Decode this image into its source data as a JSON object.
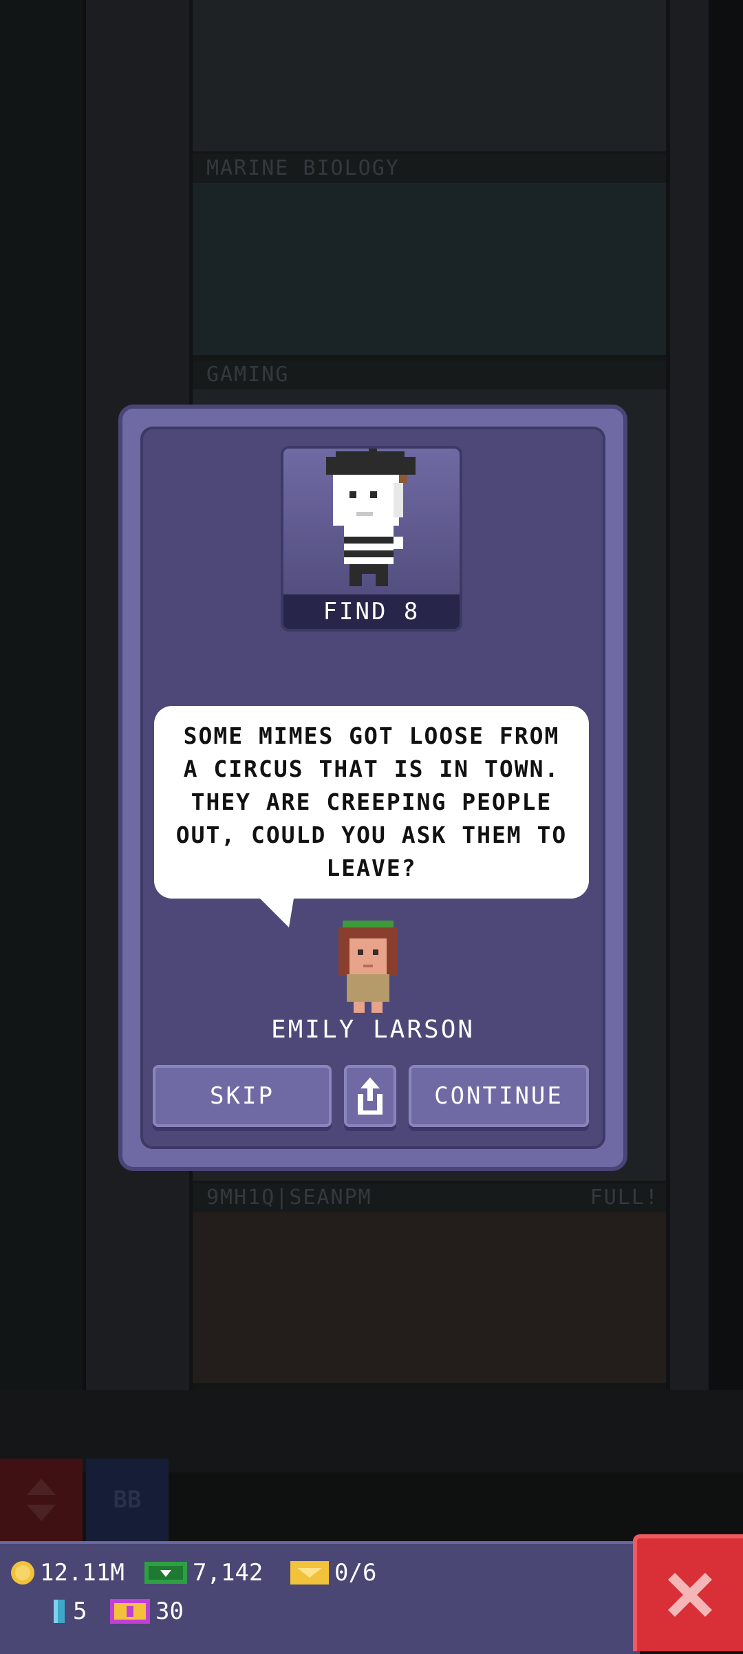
{
  "floors": [
    {
      "name": "MARINE BIOLOGY",
      "full": ""
    },
    {
      "name": "GAMING",
      "full": ""
    },
    {
      "name": "9MH1Q|SEANPM",
      "full": "FULL!"
    }
  ],
  "elevator": {
    "bb_label": "BB"
  },
  "mission": {
    "find_label": "FIND 8",
    "message": "SOME MIMES GOT LOOSE FROM A CIRCUS THAT IS IN TOWN. THEY ARE CREEPING PEOPLE OUT, COULD YOU ASK THEM TO LEAVE?",
    "speaker": "EMILY LARSON",
    "skip_label": "SKIP",
    "continue_label": "CONTINUE"
  },
  "hud": {
    "coins": "12.11M",
    "bux": "7,142",
    "tickets": "0/6",
    "keys": "5",
    "tv_count": "30"
  },
  "colors": {
    "panel": "#4d4877",
    "panel_light": "#6f6aa3",
    "close_red": "#d83036",
    "coin": "#f2c23a",
    "bux_green": "#2ea043"
  },
  "icons": {
    "coin": "coin-icon",
    "bux": "bux-icon",
    "ticket": "ticket-icon",
    "key": "key-icon",
    "tv": "tv-icon",
    "share": "share-icon",
    "close": "close-icon"
  }
}
